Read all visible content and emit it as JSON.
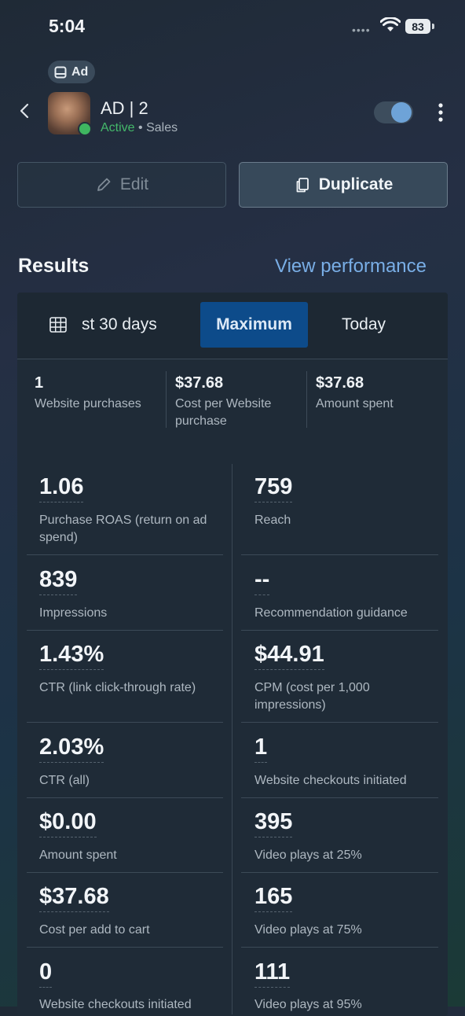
{
  "status_bar": {
    "time": "5:04",
    "battery": "83"
  },
  "ad": {
    "badge": "Ad",
    "title": "AD | 2",
    "status": "Active",
    "separator": "•",
    "objective": "Sales",
    "toggle_on": true
  },
  "actions": {
    "edit": "Edit",
    "duplicate": "Duplicate"
  },
  "results": {
    "title": "Results",
    "view_performance": "View performance",
    "tabs": [
      "st 30 days",
      "Maximum",
      "Today"
    ],
    "selected_tab": "Maximum",
    "summary": [
      {
        "value": "1",
        "label": "Website purchases"
      },
      {
        "value": "$37.68",
        "label": "Cost per Website purchase"
      },
      {
        "value": "$37.68",
        "label": "Amount spent"
      }
    ],
    "metrics_left": [
      {
        "value": "1.06",
        "label": "Purchase ROAS (return on ad spend)"
      },
      {
        "value": "839",
        "label": "Impressions"
      },
      {
        "value": "1.43%",
        "label": "CTR (link click-through rate)"
      },
      {
        "value": "2.03%",
        "label": "CTR (all)"
      },
      {
        "value": "$0.00",
        "label": "Amount spent"
      },
      {
        "value": "$37.68",
        "label": "Cost per add to cart"
      },
      {
        "value": "0",
        "label": "Website checkouts initiated"
      }
    ],
    "metrics_right": [
      {
        "value": "759",
        "label": "Reach"
      },
      {
        "value": "--",
        "label": "Recommendation guidance"
      },
      {
        "value": "$44.91",
        "label": "CPM (cost per 1,000 impressions)"
      },
      {
        "value": "1",
        "label": "Website checkouts initiated"
      },
      {
        "value": "395",
        "label": "Video plays at 25%"
      },
      {
        "value": "165",
        "label": "Video plays at 75%"
      },
      {
        "value": "111",
        "label": "Video plays at 95%"
      }
    ]
  },
  "colors": {
    "accent": "#79aee6",
    "active_green": "#44b86a",
    "selected_tab": "#0d4b8a"
  }
}
